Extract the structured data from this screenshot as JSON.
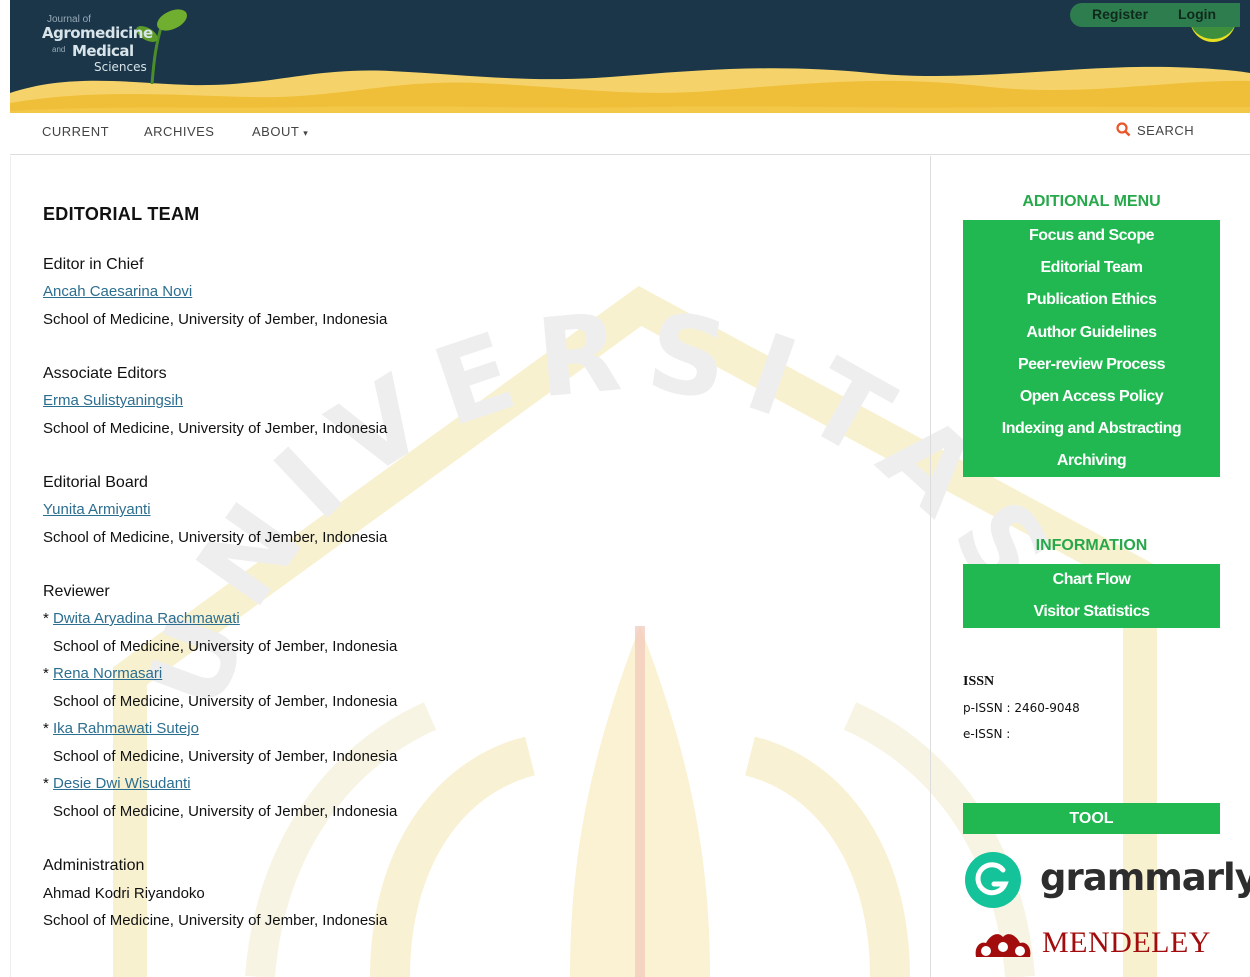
{
  "header": {
    "logo": {
      "line1": "Journal of",
      "line2": "Agromedicine",
      "and": "and",
      "line3": "Medical",
      "line4": "Sciences"
    },
    "register_label": "Register",
    "login_label": "Login",
    "colors": {
      "navy": "#1a3648",
      "wave_gold": "#f0bf3a",
      "wave_light": "#f6d36a"
    }
  },
  "nav": {
    "items": [
      "CURRENT",
      "ARCHIVES",
      "ABOUT"
    ],
    "search_label": "SEARCH",
    "accent": "#e8562a"
  },
  "main": {
    "title": "EDITORIAL TEAM",
    "editor_in_chief": {
      "heading": "Editor in Chief",
      "name": "Ancah Caesarina Novi",
      "affiliation": "School of Medicine, University of Jember, Indonesia"
    },
    "associate_editors": {
      "heading": "Associate Editors",
      "name": "Erma Sulistyaningsih",
      "affiliation": "School of Medicine, University of Jember, Indonesia"
    },
    "editorial_board": {
      "heading": "Editorial Board",
      "name": "Yunita Armiyanti",
      "affiliation": "School of Medicine, University of Jember, Indonesia"
    },
    "reviewer": {
      "heading": "Reviewer",
      "members": [
        {
          "bullet": "* ",
          "name": "Dwita Aryadina Rachmawati",
          "affiliation": "School of Medicine, University of Jember, Indonesia"
        },
        {
          "bullet": "* ",
          "name": "Rena Normasari",
          "affiliation": "School of Medicine, University of Jember, Indonesia"
        },
        {
          "bullet": "* ",
          "name": "Ika Rahmawati Sutejo",
          "affiliation": "School of Medicine, University of Jember, Indonesia"
        },
        {
          "bullet": "* ",
          "name": "Desie Dwi Wisudanti",
          "affiliation": "School of Medicine, University of Jember, Indonesia"
        }
      ]
    },
    "administration": {
      "heading": "Administration",
      "name": "Ahmad Kodri Riyandoko",
      "affiliation": "School of Medicine, University of Jember, Indonesia"
    }
  },
  "watermark": {
    "text": "UNIVERSITAS",
    "color": "#f5e7a0"
  },
  "sidebar": {
    "additional_menu": {
      "heading": "ADITIONAL MENU",
      "items": [
        "Focus and Scope",
        "Editorial Team",
        "Publication Ethics",
        "Author Guidelines",
        "Peer-review Process",
        "Open Access Policy",
        "Indexing and Abstracting",
        "Archiving"
      ]
    },
    "information": {
      "heading": "INFORMATION",
      "items": [
        "Chart Flow",
        "Visitor Statistics"
      ]
    },
    "issn": {
      "heading": "ISSN",
      "p_issn": "p-ISSN : 2460-9048",
      "e_issn": "e-ISSN :"
    },
    "tool": {
      "heading": "TOOL",
      "grammarly": "grammarly",
      "mendeley": "MENDELEY"
    },
    "accent": "#21b851"
  }
}
